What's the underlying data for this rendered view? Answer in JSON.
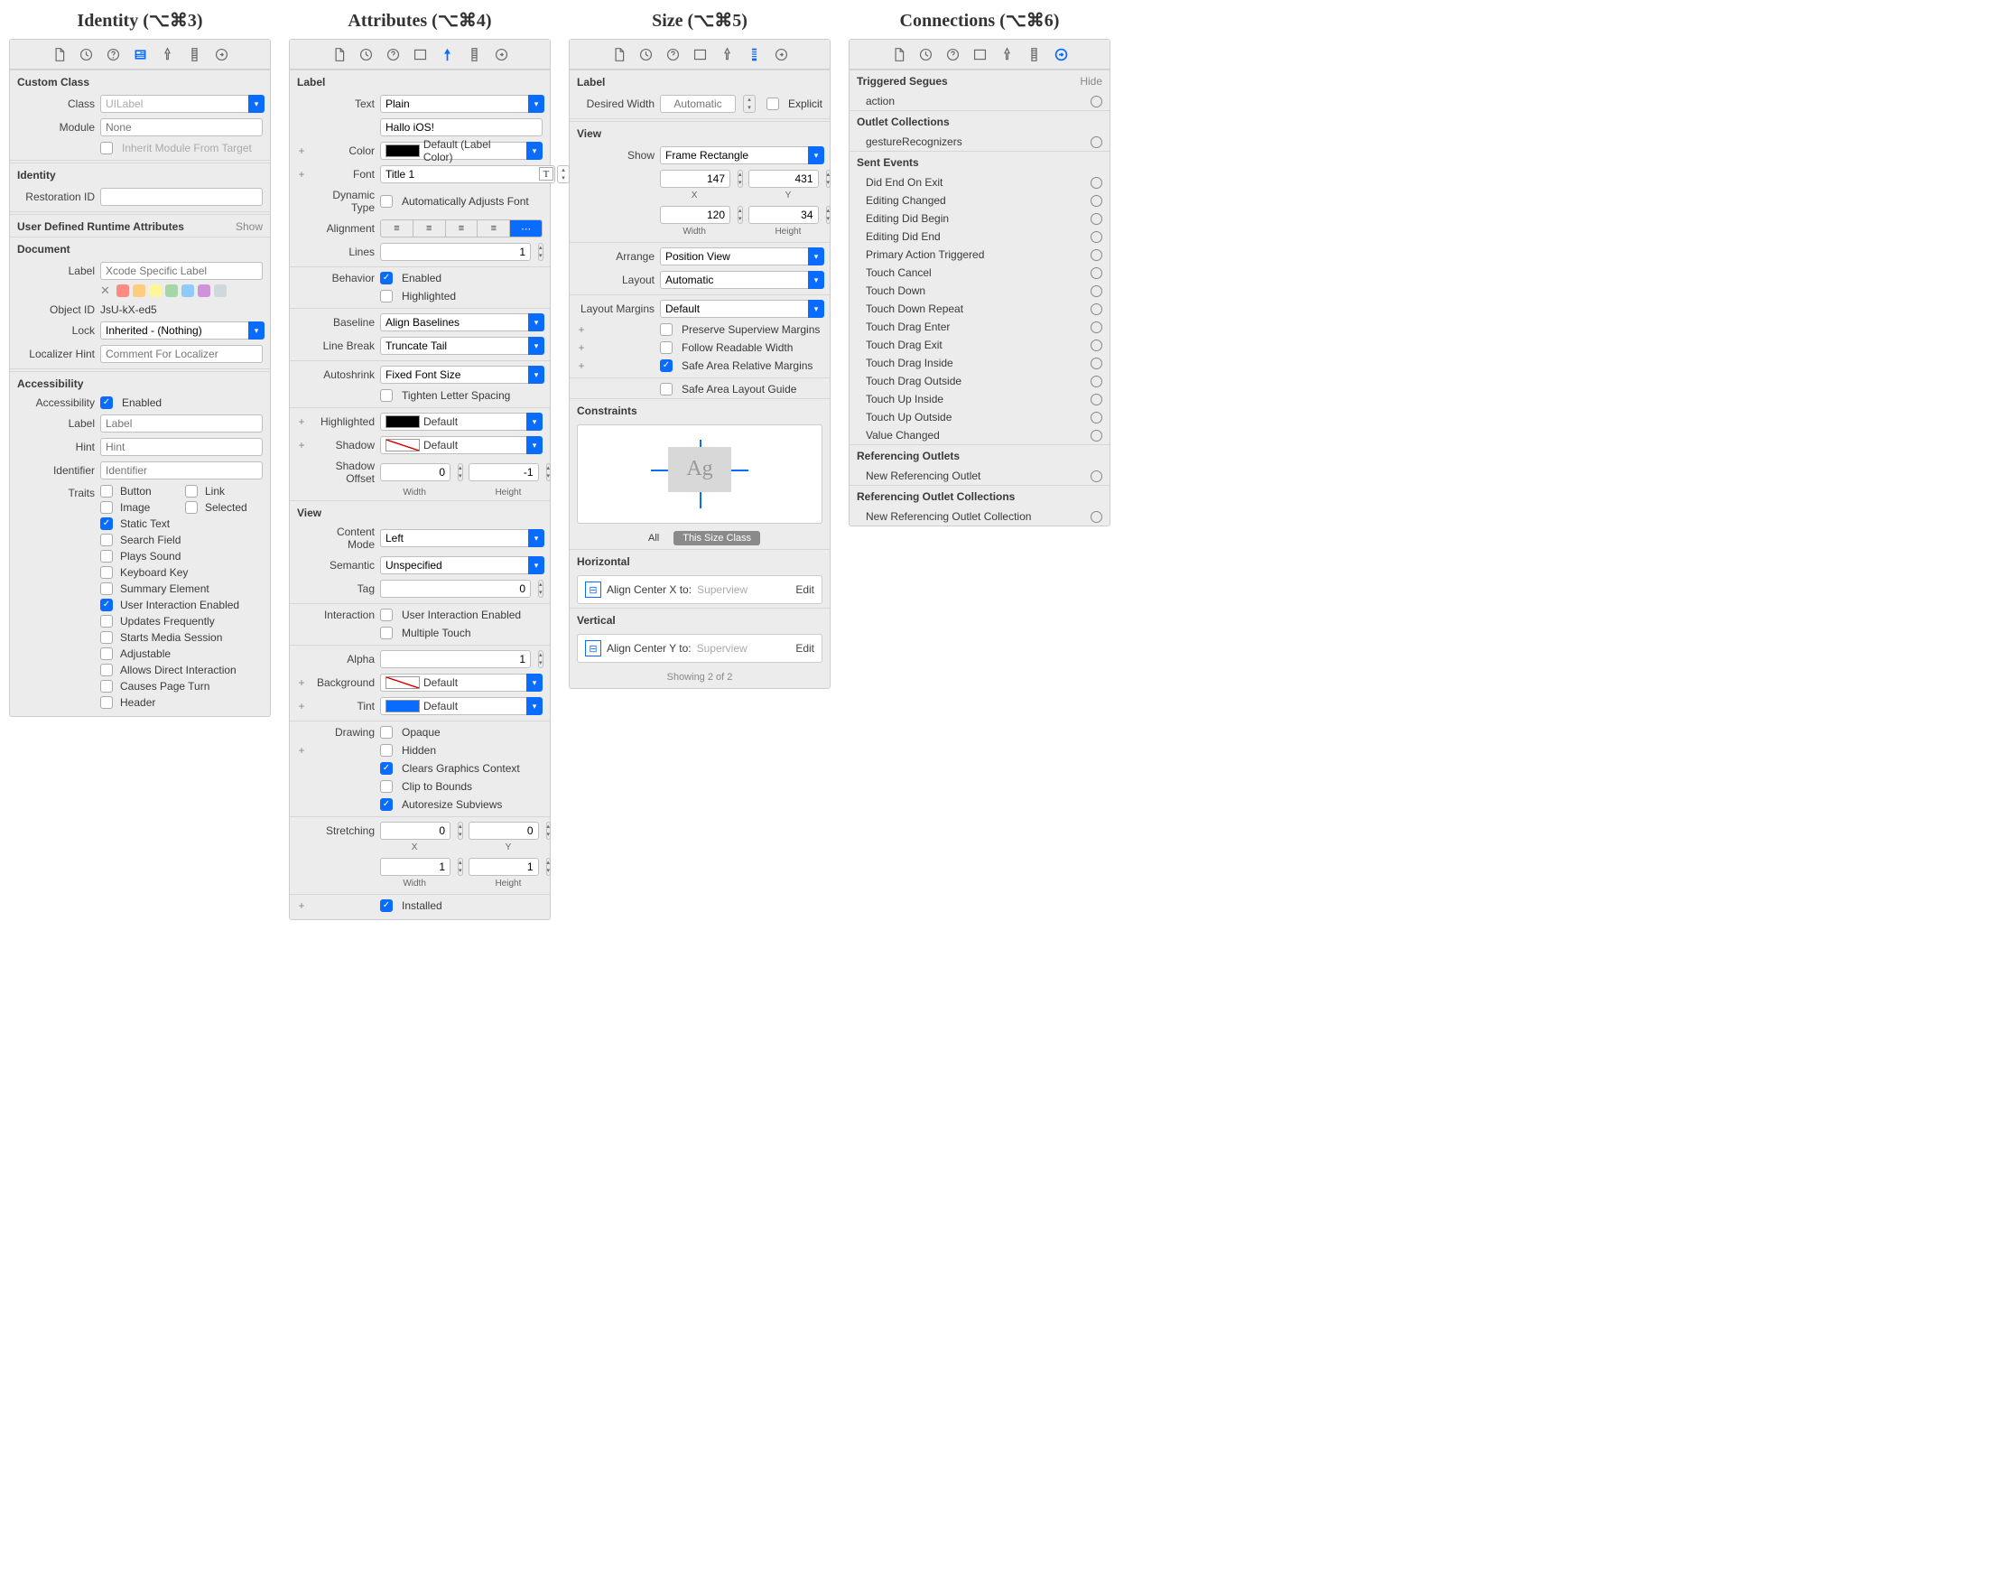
{
  "panels": {
    "identity": {
      "title": "Identity (⌥⌘3)"
    },
    "attributes": {
      "title": "Attributes (⌥⌘4)"
    },
    "size": {
      "title": "Size (⌥⌘5)"
    },
    "connections": {
      "title": "Connections (⌥⌘6)"
    }
  },
  "identity": {
    "sections": {
      "customClass": "Custom Class",
      "identity": "Identity",
      "udra": "User Defined Runtime Attributes",
      "document": "Document",
      "accessibility": "Accessibility"
    },
    "labels": {
      "class": "Class",
      "module": "Module",
      "inherit": "Inherit Module From Target",
      "restoration": "Restoration ID",
      "show": "Show",
      "docLabel": "Label",
      "objectId": "Object ID",
      "lock": "Lock",
      "localizer": "Localizer Hint",
      "a11y": "Accessibility",
      "a11yLabel": "Label",
      "hint": "Hint",
      "identifier": "Identifier",
      "traits": "Traits"
    },
    "values": {
      "class": "UILabel",
      "module": "None",
      "objectId": "JsU-kX-ed5",
      "lock": "Inherited - (Nothing)"
    },
    "placeholders": {
      "docLabel": "Xcode Specific Label",
      "localizer": "Comment For Localizer",
      "label": "Label",
      "hint": "Hint",
      "identifier": "Identifier"
    },
    "a11yEnabled": "Enabled",
    "traits": [
      {
        "label": "Button",
        "on": false
      },
      {
        "label": "Link",
        "on": false
      },
      {
        "label": "Image",
        "on": false
      },
      {
        "label": "Selected",
        "on": false
      },
      {
        "label": "Static Text",
        "on": true
      },
      {
        "label": "Search Field",
        "on": false
      },
      {
        "label": "Plays Sound",
        "on": false
      },
      {
        "label": "Keyboard Key",
        "on": false
      },
      {
        "label": "Summary Element",
        "on": false
      },
      {
        "label": "User Interaction Enabled",
        "on": true
      },
      {
        "label": "Updates Frequently",
        "on": false
      },
      {
        "label": "Starts Media Session",
        "on": false
      },
      {
        "label": "Adjustable",
        "on": false
      },
      {
        "label": "Allows Direct Interaction",
        "on": false
      },
      {
        "label": "Causes Page Turn",
        "on": false
      },
      {
        "label": "Header",
        "on": false
      }
    ]
  },
  "attributes": {
    "sections": {
      "label": "Label",
      "view": "View"
    },
    "labels": {
      "text": "Text",
      "color": "Color",
      "font": "Font",
      "dynamicType": "Dynamic Type",
      "alignment": "Alignment",
      "lines": "Lines",
      "behavior": "Behavior",
      "baseline": "Baseline",
      "lineBreak": "Line Break",
      "autoshrink": "Autoshrink",
      "highlightedC": "Highlighted",
      "shadow": "Shadow",
      "shadowOffset": "Shadow Offset",
      "contentMode": "Content Mode",
      "semantic": "Semantic",
      "tag": "Tag",
      "interaction": "Interaction",
      "alpha": "Alpha",
      "background": "Background",
      "tint": "Tint",
      "drawing": "Drawing",
      "stretching": "Stretching",
      "width": "Width",
      "height": "Height",
      "x": "X",
      "y": "Y"
    },
    "values": {
      "textMode": "Plain",
      "textValue": "Hallo iOS!",
      "color": "Default (Label Color)",
      "font": "Title 1",
      "autoAdjust": "Automatically Adjusts Font",
      "lines": "1",
      "enabled": "Enabled",
      "highlighted": "Highlighted",
      "baseline": "Align Baselines",
      "lineBreak": "Truncate Tail",
      "autoshrink": "Fixed Font Size",
      "tighten": "Tighten Letter Spacing",
      "highlightedC": "Default",
      "shadow": "Default",
      "offsetW": "0",
      "offsetH": "-1",
      "contentMode": "Left",
      "semantic": "Unspecified",
      "tag": "0",
      "uie": "User Interaction Enabled",
      "multitouch": "Multiple Touch",
      "alpha": "1",
      "background": "Default",
      "tint": "Default",
      "opaque": "Opaque",
      "hidden": "Hidden",
      "clearsGC": "Clears Graphics Context",
      "clip": "Clip to Bounds",
      "autoresize": "Autoresize Subviews",
      "stretchX": "0",
      "stretchY": "0",
      "stretchW": "1",
      "stretchH": "1",
      "installed": "Installed"
    }
  },
  "size": {
    "sections": {
      "label": "Label",
      "view": "View",
      "constraints": "Constraints",
      "horizontal": "Horizontal",
      "vertical": "Vertical"
    },
    "labels": {
      "desiredWidth": "Desired Width",
      "explicit": "Explicit",
      "show": "Show",
      "x": "X",
      "y": "Y",
      "width": "Width",
      "height": "Height",
      "arrange": "Arrange",
      "layout": "Layout",
      "layoutMargins": "Layout Margins",
      "preserve": "Preserve Superview Margins",
      "followRW": "Follow Readable Width",
      "safeRel": "Safe Area Relative Margins",
      "safeGuide": "Safe Area Layout Guide",
      "all": "All",
      "thisSize": "This Size Class",
      "edit": "Edit",
      "alignX": "Align Center X to:",
      "alignY": "Align Center Y to:",
      "superview": "Superview",
      "showing": "Showing 2 of 2",
      "automatic": "Automatic"
    },
    "values": {
      "show": "Frame Rectangle",
      "x": "147",
      "y": "431",
      "width": "120",
      "height": "34",
      "arrange": "Position View",
      "layout": "Automatic",
      "margins": "Default"
    }
  },
  "connections": {
    "sections": {
      "segues": "Triggered Segues",
      "outletCol": "Outlet Collections",
      "sent": "Sent Events",
      "refOut": "Referencing Outlets",
      "refOutCol": "Referencing Outlet Collections"
    },
    "hide": "Hide",
    "segues": [
      "action"
    ],
    "outletCol": [
      "gestureRecognizers"
    ],
    "sent": [
      "Did End On Exit",
      "Editing Changed",
      "Editing Did Begin",
      "Editing Did End",
      "Primary Action Triggered",
      "Touch Cancel",
      "Touch Down",
      "Touch Down Repeat",
      "Touch Drag Enter",
      "Touch Drag Exit",
      "Touch Drag Inside",
      "Touch Drag Outside",
      "Touch Up Inside",
      "Touch Up Outside",
      "Value Changed"
    ],
    "refOut": [
      "New Referencing Outlet"
    ],
    "refOutCol": [
      "New Referencing Outlet Collection"
    ]
  }
}
